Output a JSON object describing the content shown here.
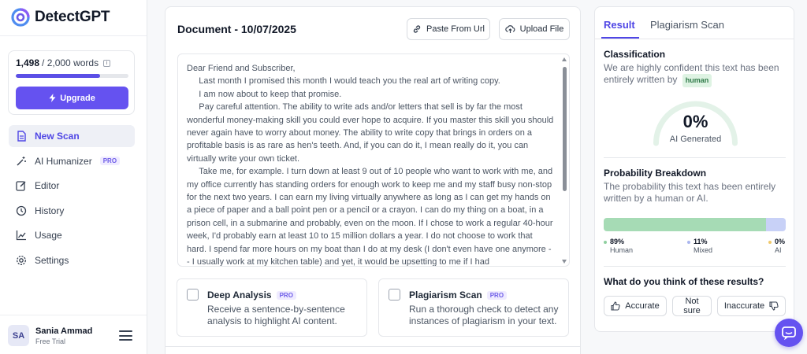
{
  "app": {
    "name": "DetectGPT"
  },
  "credits": {
    "used": "1,498",
    "total": "/ 2,000 words",
    "progress": 0.749
  },
  "sidebar": {
    "upgrade_label": "Upgrade",
    "items": [
      {
        "label": "New Scan",
        "icon": "document-icon",
        "active": true
      },
      {
        "label": "AI Humanizer",
        "icon": "magic-wand-icon",
        "badge": "PRO"
      },
      {
        "label": "Editor",
        "icon": "edit-icon"
      },
      {
        "label": "History",
        "icon": "history-icon"
      },
      {
        "label": "Usage",
        "icon": "chart-icon"
      },
      {
        "label": "Settings",
        "icon": "gear-icon"
      }
    ]
  },
  "user": {
    "initials": "SA",
    "name": "Sania Ammad",
    "plan": "Free Trial"
  },
  "document": {
    "title": "Document - 10/07/2025",
    "paste_label": "Paste From Url",
    "upload_label": "Upload File",
    "text": "Dear Friend and Subscriber,\n     Last month I promised this month I would teach you the real art of writing copy.\n     I am now about to keep that promise.\n     Pay careful attention. The ability to write ads and/or letters that sell is by far the most wonderful money-making skill you could ever hope to acquire. If you master this skill you should never again have to worry about money. The ability to write copy that brings in orders on a profitable basis is as rare as hen's teeth. And, if you can do it, I mean really do it, you can virtually write your own ticket.\n     Take me, for example. I turn down at least 9 out of 10 people who want to work with me, and my office currently has standing orders for enough work to keep me and my staff busy non-stop for the next two years. I can earn my living virtually anywhere as long as I can get my hands on a piece of paper and a ball point pen or a pencil or a crayon. I can do my thing on a boat, in a prison cell, in a submarine and probably, even on the moon. If I chose to work a regular 40-hour week, I'd probably earn at least 10 to 15 million dollars a year. I do not choose to work that hard. I spend far more hours on my boat than I do at my desk (I don't even have one anymore -- I usually work at my kitchen table) and yet, it would be upsetting to me if I had"
  },
  "options": [
    {
      "title": "Deep Analysis",
      "badge": "PRO",
      "desc": "Receive a sentence-by-sentence analysis to highlight AI content."
    },
    {
      "title": "Plagiarism Scan",
      "badge": "PRO",
      "desc": "Run a thorough check to detect any instances of plagiarism in your text."
    }
  ],
  "results": {
    "tabs": [
      "Result",
      "Plagiarism Scan"
    ],
    "classification": {
      "title": "Classification",
      "text": "We are highly confident this text has been entirely written by",
      "tag": "human"
    },
    "gauge": {
      "value": "0%",
      "label": "AI Generated",
      "fraction": 0
    },
    "breakdown": {
      "title": "Probability Breakdown",
      "text": "The probability this text has been entirely written by a human or AI.",
      "items": [
        {
          "pct": "89%",
          "label": "Human",
          "value": 89,
          "color": "#a6dbb5",
          "dot": "#8fcf9f"
        },
        {
          "pct": "11%",
          "label": "Mixed",
          "value": 11,
          "color": "#c8d1f7",
          "dot": "#aab6ef"
        },
        {
          "pct": "0%",
          "label": "AI",
          "value": 0,
          "color": "#f4d9a0",
          "dot": "#f0c96b"
        }
      ]
    },
    "feedback": {
      "title": "What do you think of these results?",
      "accurate": "Accurate",
      "not_sure": "Not sure",
      "inaccurate": "Inaccurate"
    }
  },
  "colors": {
    "accent": "#6552f0",
    "human_green": "#a6dbb5",
    "mixed_blue": "#c8d1f7"
  }
}
